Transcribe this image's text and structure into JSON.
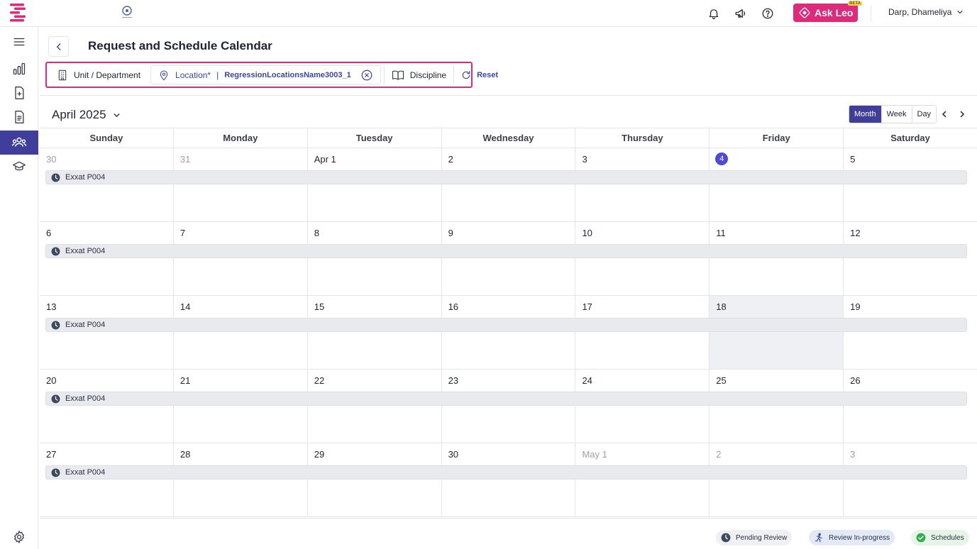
{
  "header": {
    "title": "Request and Schedule Calendar",
    "ask_leo": {
      "label": "Ask Leo",
      "badge": "BETA"
    },
    "user_name": "Darp, Dhameliya"
  },
  "sidebar": {
    "items": [
      {
        "icon": "menu-icon"
      },
      {
        "icon": "bar-chart-icon"
      },
      {
        "icon": "add-document-icon"
      },
      {
        "icon": "document-icon"
      },
      {
        "icon": "people-icon",
        "active": true
      },
      {
        "icon": "graduation-cap-icon"
      },
      {
        "icon": "gear-icon"
      }
    ]
  },
  "filters": {
    "unit_label": "Unit / Department",
    "location_label": "Location*",
    "location_separator": "|",
    "location_value": "RegressionLocationsName3003_1",
    "discipline_label": "Discipline",
    "reset_label": "Reset"
  },
  "calendar": {
    "month_label": "April 2025",
    "views": [
      "Month",
      "Week",
      "Day"
    ],
    "active_view": "Month",
    "weekdays": [
      "Sunday",
      "Monday",
      "Tuesday",
      "Wednesday",
      "Thursday",
      "Friday",
      "Saturday"
    ],
    "weeks": [
      {
        "days": [
          "30",
          "31",
          "Apr 1",
          "2",
          "3",
          "4",
          "5"
        ],
        "event": "Exxat P004"
      },
      {
        "days": [
          "6",
          "7",
          "8",
          "9",
          "10",
          "11",
          "12"
        ],
        "event": "Exxat P004"
      },
      {
        "days": [
          "13",
          "14",
          "15",
          "16",
          "17",
          "18",
          "19"
        ],
        "event": "Exxat P004"
      },
      {
        "days": [
          "20",
          "21",
          "22",
          "23",
          "24",
          "25",
          "26"
        ],
        "event": "Exxat P004"
      },
      {
        "days": [
          "27",
          "28",
          "29",
          "30",
          "May 1",
          "2",
          "3"
        ],
        "event": "Exxat P004"
      }
    ],
    "today": "4"
  },
  "legend": {
    "pending": "Pending Review",
    "in_progress": "Review In-progress",
    "schedules": "Schedules"
  },
  "colors": {
    "accent": "#3f3f9b",
    "brand": "#e0297a",
    "today": "#5048d6",
    "schedules_green": "#2fb04a"
  }
}
